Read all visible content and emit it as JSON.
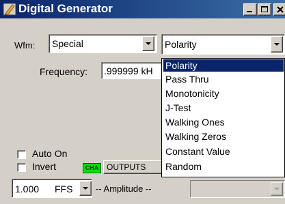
{
  "window": {
    "title": "Digital Generator",
    "controls": [
      "minimize",
      "maximize",
      "close"
    ]
  },
  "waveform": {
    "label": "Wfm:",
    "value": "Special"
  },
  "special_type": {
    "value": "Polarity",
    "options": [
      "Polarity",
      "Pass Thru",
      "Monotonicity",
      "J-Test",
      "Walking Ones",
      "Walking Zeros",
      "Constant Value",
      "Random"
    ],
    "selected_index": 0
  },
  "frequency": {
    "label": "Frequency:",
    "value": ".999999 kH"
  },
  "options": {
    "auto_on_label": "Auto On",
    "auto_on_checked": false,
    "invert_label": "Invert",
    "invert_checked": false
  },
  "channel_badge": "CHA",
  "outputs_label": "OUTPUTS",
  "amplitude": {
    "value": "1.000",
    "unit": "FFS",
    "label": "-- Amplitude --"
  },
  "colors": {
    "titlebar_start": "#0a246a",
    "titlebar_end": "#3a6ea5",
    "selection": "#0a246a",
    "badge": "#00e000",
    "face": "#d4d0c8"
  }
}
